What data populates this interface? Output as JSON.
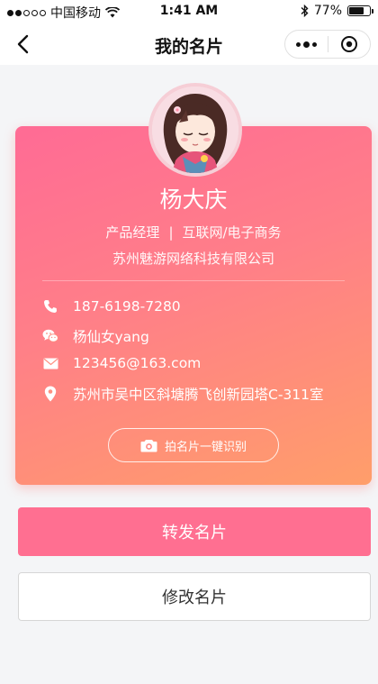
{
  "status_bar": {
    "carrier": "中国移动",
    "time": "1:41 AM",
    "battery_text": "77%",
    "battery_level": 0.77
  },
  "nav": {
    "title": "我的名片"
  },
  "card": {
    "name": "杨大庆",
    "position": "产品经理",
    "separator": "|",
    "industry": "互联网/电子商务",
    "company": "苏州魅游网络科技有限公司",
    "phone": "187-6198-7280",
    "wechat": "杨仙女yang",
    "email": "123456@163.com",
    "address": "苏州市吴中区斜塘腾飞创新园塔C-311室",
    "scan_label": "拍名片一键识别"
  },
  "actions": {
    "forward_label": "转发名片",
    "edit_label": "修改名片"
  },
  "icons": {
    "phone": "phone-icon",
    "wechat": "wechat-icon",
    "email": "mail-icon",
    "address": "location-pin-icon",
    "scan": "camera-icon"
  },
  "colors": {
    "card_gradient_start": "#ff6b95",
    "card_gradient_end": "#ff9e6a",
    "primary_button": "#ff6f91",
    "background": "#f4f5f7"
  }
}
